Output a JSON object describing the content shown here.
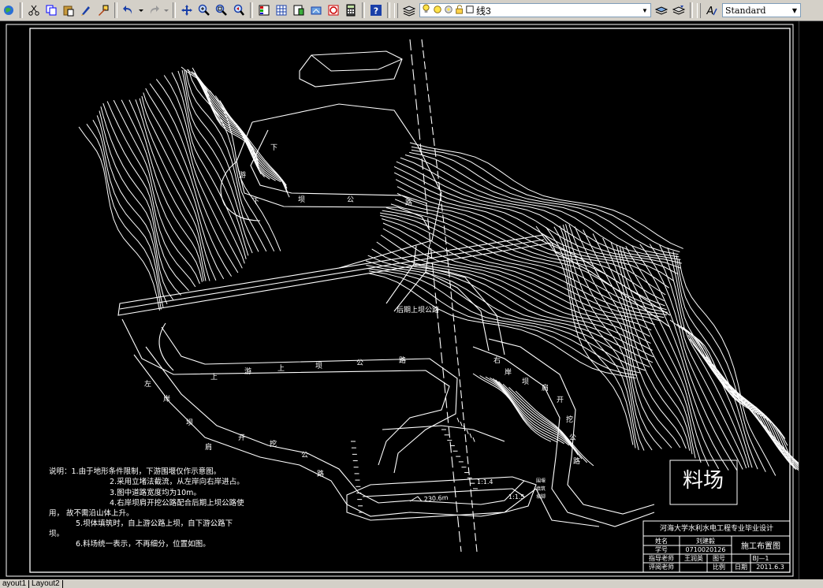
{
  "toolbar": {
    "layer_name": "线3",
    "text_style": "Standard"
  },
  "drawing": {
    "road_upstream_lower": [
      "下",
      "游",
      "下",
      "坝",
      "公",
      "路"
    ],
    "road_later_upper": "后期上坝公路",
    "road_upstream_upper": [
      "上",
      "游",
      "上",
      "坝",
      "公",
      "路"
    ],
    "road_left_bank": [
      "左",
      "岸",
      "坝",
      "肩",
      "开",
      "挖",
      "公",
      "路"
    ],
    "road_right_bank": [
      "右",
      "岸",
      "坝",
      "肩",
      "开",
      "挖",
      "公",
      "路"
    ],
    "dimension_length": "230.6m",
    "dimension_side": "11.5",
    "small_label_1": "1:1.4",
    "small_label_2": "1:1.5",
    "stockyard_label": "料场",
    "side_note": [
      "围堰",
      "填筑",
      "坡脚"
    ]
  },
  "notes": [
    "说明：1.由于地形条件限制，下游围堰仅作示意图。",
    "2.采用立堵法截流，从左岸向右岸进占。",
    "3.图中道路宽度均为10m。",
    "4.右岸坝肩开挖公路配合后期上坝公路使",
    "用，  故不需沿山体上升。",
    "5.坝体填筑时，自上游公路上坝，自下游公路下",
    "坝。",
    "6.料场统一表示，不再细分，位置如图。"
  ],
  "title_block": {
    "school": "河海大学水利水电工程专业毕业设计",
    "name_label": "姓名",
    "name_value": "刘建毅",
    "id_label": "学号",
    "id_value": "0710020126",
    "drawing_title": "施工布置图",
    "advisor_label": "指导老师",
    "advisor_value": "王润英",
    "drawing_no_label": "图号",
    "drawing_no_value": "BJ—1",
    "reviewer_label": "评阅老师",
    "scale_label": "比例",
    "date_label": "日期",
    "date_value": "2011.6.3"
  },
  "layout_tabs": [
    "ayout1",
    "Layout2"
  ]
}
